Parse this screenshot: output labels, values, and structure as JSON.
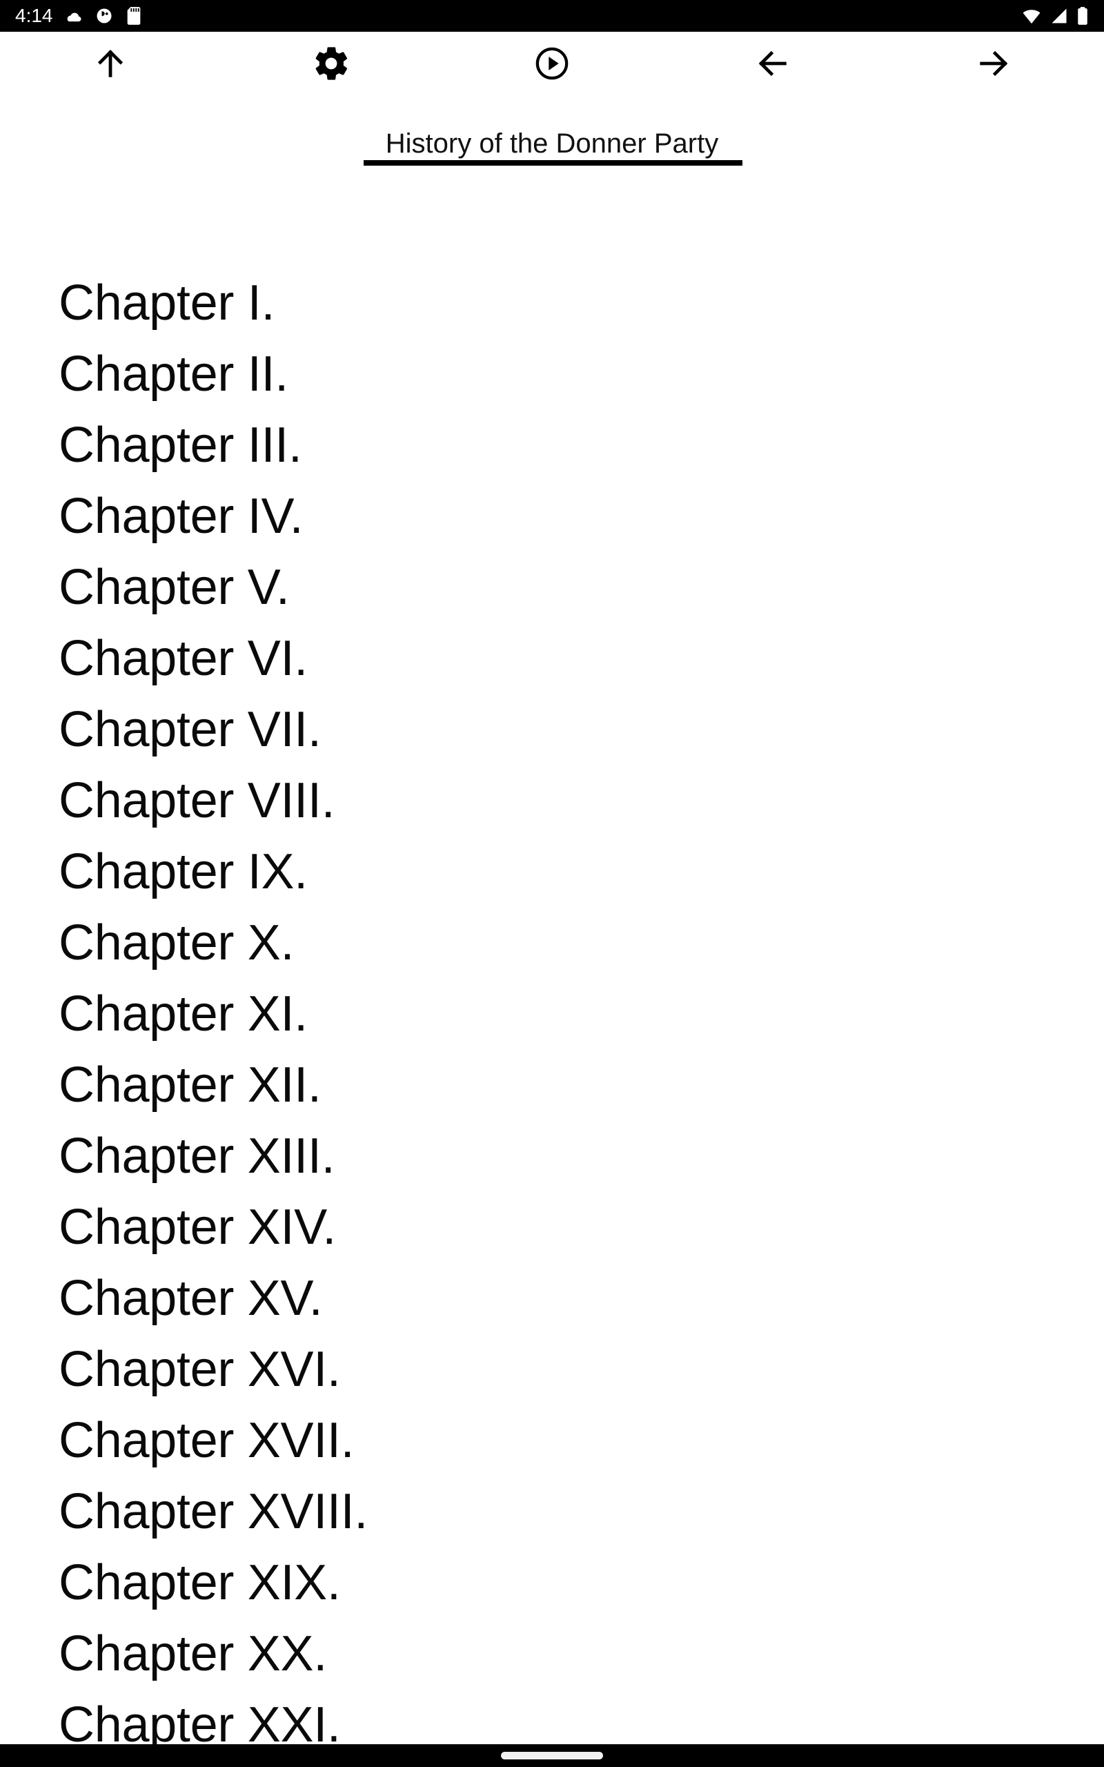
{
  "status_bar": {
    "clock": "4:14",
    "left_icons": [
      {
        "name": "notification-cloud-icon",
        "glyph": "cloud"
      },
      {
        "name": "media-circle-icon",
        "glyph": "circle-half"
      },
      {
        "name": "sd-card-icon",
        "glyph": "sd-card"
      }
    ],
    "right_icons": [
      {
        "name": "wifi-icon",
        "glyph": "wifi"
      },
      {
        "name": "cellular-signal-icon",
        "glyph": "signal"
      },
      {
        "name": "battery-icon",
        "glyph": "battery"
      }
    ],
    "background_color": "#000000",
    "foreground_color": "#ffffff"
  },
  "toolbar": {
    "buttons": [
      {
        "name": "scroll-to-top-button",
        "icon": "arrow-up-icon",
        "label": "Scroll to top"
      },
      {
        "name": "settings-button",
        "icon": "gear-icon",
        "label": "Settings"
      },
      {
        "name": "play-button",
        "icon": "play-circle-icon",
        "label": "Play"
      },
      {
        "name": "back-button",
        "icon": "arrow-left-icon",
        "label": "Back"
      },
      {
        "name": "forward-button",
        "icon": "arrow-right-icon",
        "label": "Forward"
      }
    ],
    "background_color": "#ffffff",
    "icon_color": "#000000"
  },
  "header": {
    "title": "History of the Donner Party",
    "rule_color": "#000000"
  },
  "main": {
    "chapters": [
      "Chapter I.",
      "Chapter II.",
      "Chapter III.",
      "Chapter IV.",
      "Chapter V.",
      "Chapter VI.",
      "Chapter VII.",
      "Chapter VIII.",
      "Chapter IX.",
      "Chapter X.",
      "Chapter XI.",
      "Chapter XII.",
      "Chapter XIII.",
      "Chapter XIV.",
      "Chapter XV.",
      "Chapter XVI.",
      "Chapter XVII.",
      "Chapter XVIII.",
      "Chapter XIX.",
      "Chapter XX.",
      "Chapter XXI."
    ],
    "text_color": "#0a0a0a",
    "background_color": "#ffffff"
  },
  "nav_bar": {
    "gesture_pill": "home-gesture-pill",
    "background_color": "#000000",
    "pill_color": "#f1f1f1"
  }
}
